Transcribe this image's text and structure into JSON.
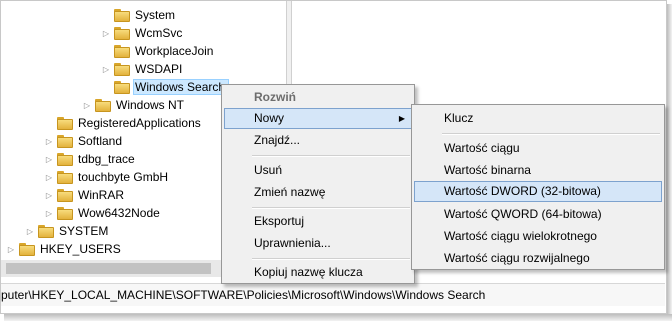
{
  "tree": {
    "nodes": [
      {
        "label": "System",
        "expander": "",
        "selected": false
      },
      {
        "label": "WcmSvc",
        "expander": "▷",
        "selected": false
      },
      {
        "label": "WorkplaceJoin",
        "expander": "",
        "selected": false
      },
      {
        "label": "WSDAPI",
        "expander": "▷",
        "selected": false
      },
      {
        "label": "Windows Search",
        "expander": "",
        "selected": true
      },
      {
        "label": "Windows NT",
        "expander": "▷",
        "selected": false
      },
      {
        "label": "RegisteredApplications",
        "expander": "",
        "selected": false
      },
      {
        "label": "Softland",
        "expander": "▷",
        "selected": false
      },
      {
        "label": "tdbg_trace",
        "expander": "▷",
        "selected": false
      },
      {
        "label": "touchbyte GmbH",
        "expander": "▷",
        "selected": false
      },
      {
        "label": "WinRAR",
        "expander": "▷",
        "selected": false
      },
      {
        "label": "Wow6432Node",
        "expander": "▷",
        "selected": false
      },
      {
        "label": "SYSTEM",
        "expander": "▷",
        "selected": false
      },
      {
        "label": "HKEY_USERS",
        "expander": "▷",
        "selected": false
      }
    ],
    "folder_icon": "folder-icon"
  },
  "status_bar": {
    "path": "puter\\HKEY_LOCAL_MACHINE\\SOFTWARE\\Policies\\Microsoft\\Windows\\Windows Search"
  },
  "context_menu": {
    "items": [
      {
        "label": "Rozwiń",
        "state": "disabled-bold"
      },
      {
        "label": "Nowy",
        "state": "highlighted",
        "submenu_arrow": "▶"
      },
      {
        "label": "Znajdź..."
      },
      {
        "label": "Usuń"
      },
      {
        "label": "Zmień nazwę"
      },
      {
        "label": "Eksportuj"
      },
      {
        "label": "Uprawnienia..."
      },
      {
        "label": "Kopiuj nazwę klucza"
      }
    ]
  },
  "submenu": {
    "items": [
      {
        "label": "Klucz"
      },
      {
        "label": "Wartość ciągu"
      },
      {
        "label": "Wartość binarna"
      },
      {
        "label": "Wartość DWORD (32-bitowa)",
        "state": "highlighted"
      },
      {
        "label": "Wartość QWORD (64-bitowa)"
      },
      {
        "label": "Wartość ciągu wielokrotnego"
      },
      {
        "label": "Wartość ciągu rozwijalnego"
      }
    ]
  },
  "colors": {
    "selection": "#cce8ff",
    "menu_highlight": "#d5e6f8",
    "menu_bg": "#f0f0f0",
    "folder": "#e3b23c"
  }
}
